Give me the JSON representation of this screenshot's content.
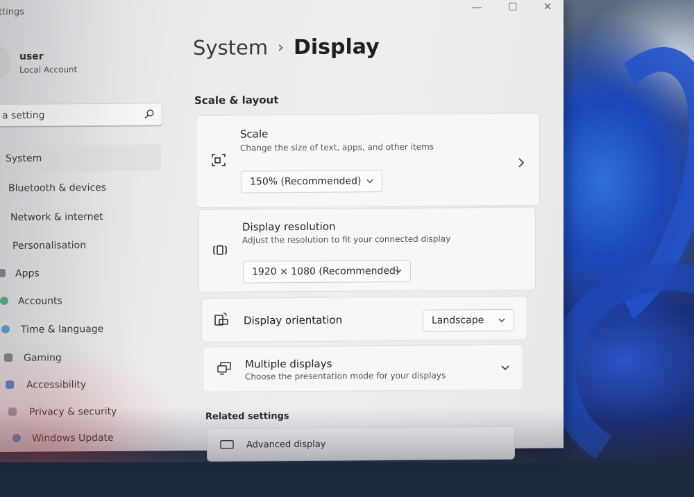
{
  "window": {
    "title": "ttings",
    "min_glyph": "—",
    "max_glyph": "☐",
    "close_glyph": "✕"
  },
  "profile": {
    "name": "user",
    "account_type": "Local Account"
  },
  "search": {
    "value": "a setting"
  },
  "sidebar": {
    "items": [
      {
        "label": "System",
        "icon": "system-icon",
        "color": "#4a7fd1",
        "active": true
      },
      {
        "label": "Bluetooth & devices",
        "icon": "bluetooth-icon",
        "color": "#3a76c7"
      },
      {
        "label": "Network & internet",
        "icon": "network-icon",
        "color": "#5a6b86"
      },
      {
        "label": "Personalisation",
        "icon": "brush-icon",
        "color": "#c07a3a"
      },
      {
        "label": "Apps",
        "icon": "apps-icon",
        "color": "#6a6a80"
      },
      {
        "label": "Accounts",
        "icon": "accounts-icon",
        "color": "#3aa06a"
      },
      {
        "label": "Time & language",
        "icon": "globe-icon",
        "color": "#3a8ac7"
      },
      {
        "label": "Gaming",
        "icon": "gaming-icon",
        "color": "#6a6a6a"
      },
      {
        "label": "Accessibility",
        "icon": "accessibility-icon",
        "color": "#3a62c7"
      },
      {
        "label": "Privacy & security",
        "icon": "shield-icon",
        "color": "#8a8a9a"
      },
      {
        "label": "Windows Update",
        "icon": "update-icon",
        "color": "#2f7fd8"
      }
    ]
  },
  "breadcrumb": {
    "parent": "System",
    "separator": "›",
    "current": "Display"
  },
  "main": {
    "section_title": "Scale & layout",
    "scale": {
      "title": "Scale",
      "description": "Change the size of text, apps, and other items",
      "value": "150% (Recommended)"
    },
    "resolution": {
      "title": "Display resolution",
      "description": "Adjust the resolution to fit your connected display",
      "value": "1920 × 1080 (Recommended)"
    },
    "orientation": {
      "title": "Display orientation",
      "value": "Landscape"
    },
    "multiple_displays": {
      "title": "Multiple displays",
      "description": "Choose the presentation mode for your displays"
    }
  },
  "related": {
    "title": "Related settings",
    "advanced_display": "Advanced display"
  }
}
